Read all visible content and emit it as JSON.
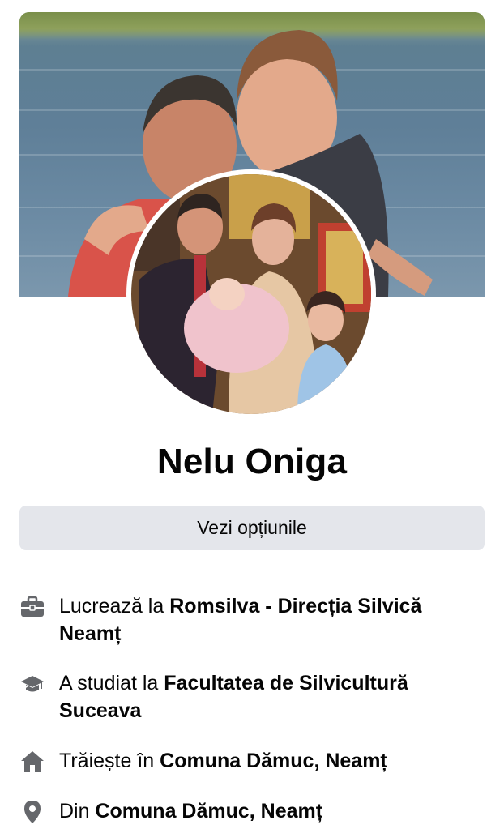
{
  "profile": {
    "name": "Nelu Oniga"
  },
  "actions": {
    "options_label": "Vezi opțiunile"
  },
  "intro": {
    "work": {
      "prefix": "Lucrează la",
      "value": "Romsilva - Direcția Silvică Neamț",
      "icon": "briefcase-icon"
    },
    "education": {
      "prefix": "A studiat la",
      "value": "Facultatea de Silvicultură Suceava",
      "icon": "graduation-cap-icon"
    },
    "lives": {
      "prefix": "Trăiește în",
      "value": "Comuna Dămuc, Neamț",
      "icon": "home-icon"
    },
    "from": {
      "prefix": "Din",
      "value": "Comuna Dămuc, Neamț",
      "icon": "location-pin-icon"
    }
  },
  "colors": {
    "icon_gray": "#65676b",
    "button_bg": "#e4e6eb",
    "text": "#050505"
  }
}
